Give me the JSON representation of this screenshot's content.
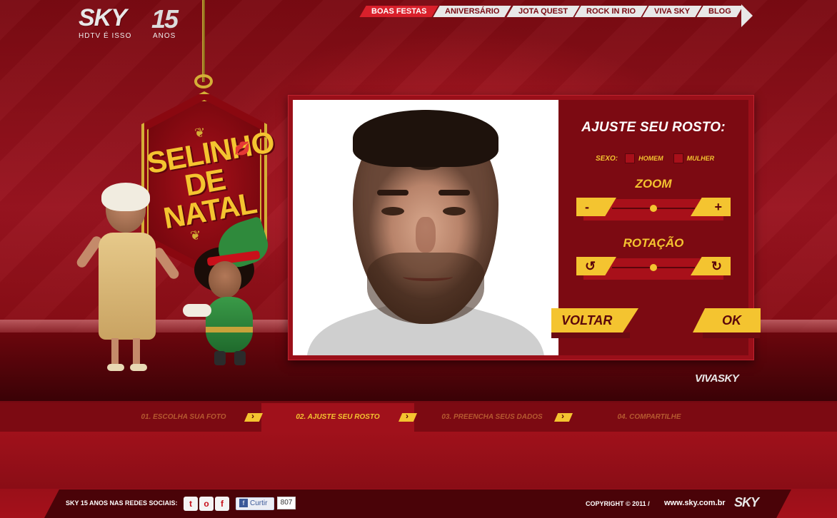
{
  "logo": {
    "brand": "SKY",
    "badge": "15",
    "tagline": "HDTV É ISSO",
    "anos": "ANOS"
  },
  "nav": {
    "items": [
      {
        "label": "BOAS FESTAS",
        "active": true
      },
      {
        "label": "ANIVERSÁRIO",
        "active": false
      },
      {
        "label": "JOTA QUEST",
        "active": false
      },
      {
        "label": "ROCK IN RIO",
        "active": false
      },
      {
        "label": "VIVA SKY",
        "active": false
      },
      {
        "label": "BLOG",
        "active": false
      }
    ]
  },
  "sign": {
    "line1": "SELINHO",
    "line2": "DE NATAL"
  },
  "editor": {
    "title": "AJUSTE SEU ROSTO:",
    "sexo_label": "SEXO:",
    "homem": "HOMEM",
    "mulher": "MULHER",
    "zoom_label": "ZOOM",
    "zoom_minus": "-",
    "zoom_plus": "+",
    "zoom_value": 0.5,
    "rotacao_label": "ROTAÇÃO",
    "rot_left_icon": "rotate-left-icon",
    "rot_right_icon": "rotate-right-icon",
    "rotation_value": 0.5,
    "voltar": "VOLTAR",
    "ok": "OK"
  },
  "vivasky": "VIVASKY",
  "steps": [
    {
      "label": "01. ESCOLHA SUA FOTO",
      "active": false
    },
    {
      "label": "02. AJUSTE SEU ROSTO",
      "active": true
    },
    {
      "label": "03. PREENCHA SEUS DADOS",
      "active": false
    },
    {
      "label": "04. COMPARTILHE",
      "active": false
    }
  ],
  "footer": {
    "social_label": "SKY 15 ANOS NAS REDES SOCIAIS:",
    "social_icons": [
      "twitter-icon",
      "orkut-icon",
      "facebook-icon"
    ],
    "like_label": "Curtir",
    "like_count": "807",
    "copyright": "COPYRIGHT © 2011   /",
    "site": "www.sky.com.br",
    "logo": "SKY"
  },
  "colors": {
    "accent_yellow": "#f4c430",
    "brand_red": "#9a0f19",
    "dark_red": "#5a050b"
  }
}
